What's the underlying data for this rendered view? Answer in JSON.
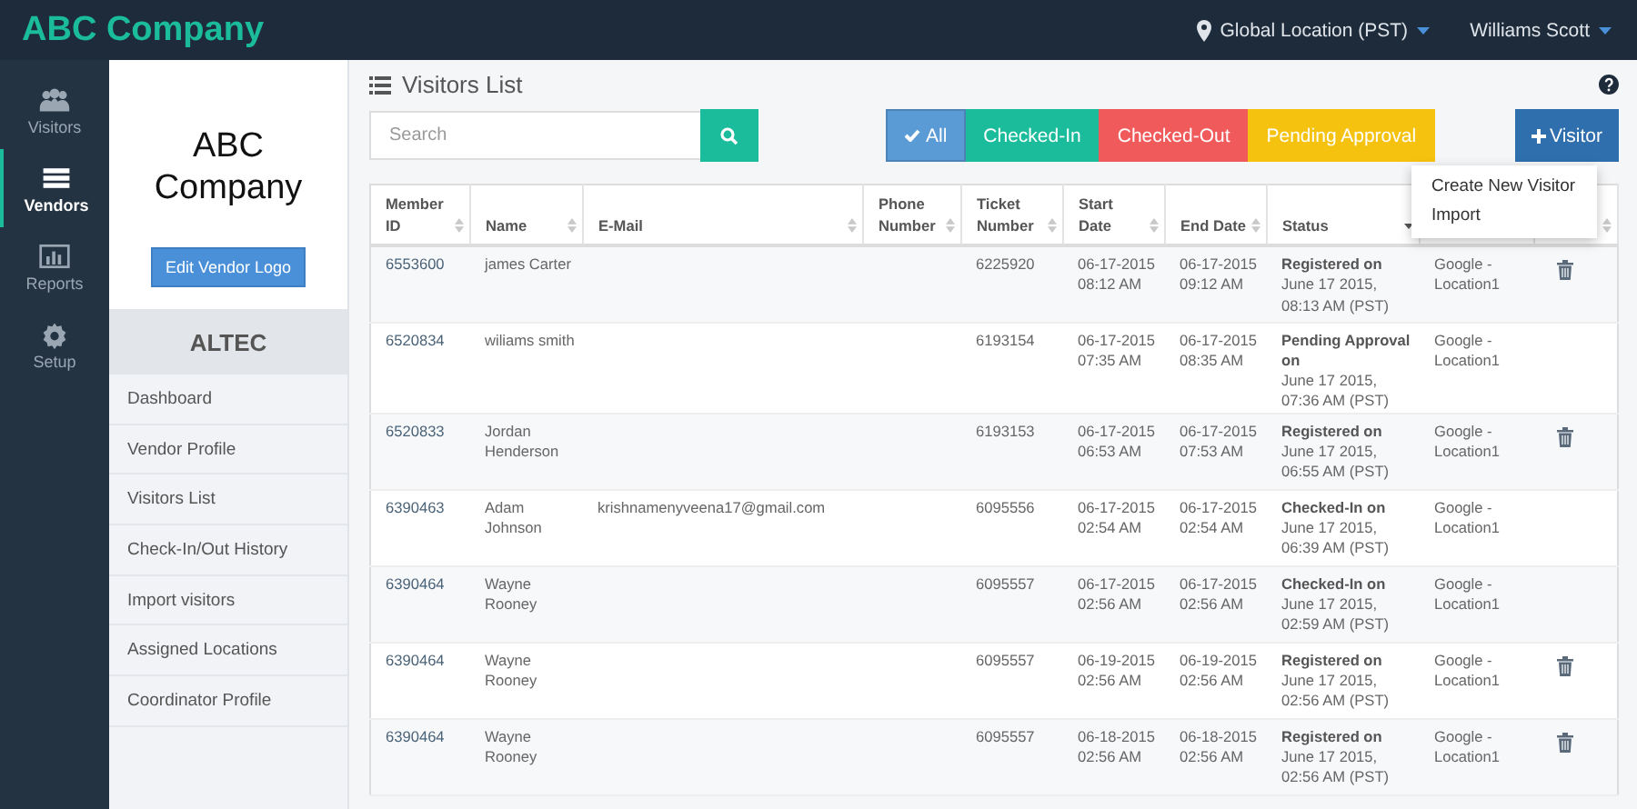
{
  "header": {
    "brand": "ABC Company",
    "location": "Global Location (PST)",
    "user": "Williams Scott"
  },
  "rail": [
    {
      "label": "Visitors",
      "selected": false
    },
    {
      "label": "Vendors",
      "selected": true
    },
    {
      "label": "Reports",
      "selected": false
    },
    {
      "label": "Setup",
      "selected": false
    }
  ],
  "vendor": {
    "logo_text": "ABC Company",
    "edit_button": "Edit Vendor Logo",
    "name": "ALTEC",
    "menu": [
      "Dashboard",
      "Vendor Profile",
      "Visitors List",
      "Check-In/Out History",
      "Import visitors",
      "Assigned Locations",
      "Coordinator Profile"
    ]
  },
  "page_title": "Visitors List",
  "search": {
    "placeholder": "Search"
  },
  "filters": [
    {
      "label": "All",
      "kind": "all",
      "selected": true
    },
    {
      "label": "Checked-In",
      "kind": "in",
      "selected": false
    },
    {
      "label": "Checked-Out",
      "kind": "out",
      "selected": false
    },
    {
      "label": "Pending Approval",
      "kind": "pending",
      "selected": false
    }
  ],
  "add_button": "Visitor",
  "add_menu": [
    "Create New Visitor",
    "Import"
  ],
  "table": {
    "columns": [
      {
        "label": "Member ID",
        "sorted": false
      },
      {
        "label": "Name",
        "sorted": false
      },
      {
        "label": "E-Mail",
        "sorted": false
      },
      {
        "label": "Phone Number",
        "sorted": false
      },
      {
        "label": "Ticket Number",
        "sorted": false
      },
      {
        "label": "Start Date",
        "sorted": false
      },
      {
        "label": "End Date",
        "sorted": false
      },
      {
        "label": "Status",
        "sorted": true
      },
      {},
      {
        "sorted": false
      }
    ],
    "rows": [
      {
        "member_id": "6553600",
        "name": "james Carter",
        "ticket": "6225920",
        "start": "06-17-2015 08:12 AM",
        "end": "06-17-2015 09:12 AM",
        "status": "Registered on",
        "status_detail": "June 17 2015, 08:13 AM (PST)",
        "location": "Google - Location1",
        "deletable": true
      },
      {
        "member_id": "6520834",
        "name": "wiliams smith",
        "ticket": "6193154",
        "start": "06-17-2015 07:35 AM",
        "end": "06-17-2015 08:35 AM",
        "status": "Pending Approval on",
        "status_detail": "June 17 2015, 07:36 AM (PST)",
        "location": "Google - Location1",
        "deletable": false
      },
      {
        "member_id": "6520833",
        "name": "Jordan Henderson",
        "ticket": "6193153",
        "start": "06-17-2015 06:53 AM",
        "end": "06-17-2015 07:53 AM",
        "status": "Registered on",
        "status_detail": "June 17 2015, 06:55 AM (PST)",
        "location": "Google - Location1",
        "deletable": true
      },
      {
        "member_id": "6390463",
        "name": "Adam Johnson",
        "email": "krishnamenyveena17@gmail.com",
        "ticket": "6095556",
        "start": "06-17-2015 02:54 AM",
        "end": "06-17-2015 02:54 AM",
        "status": "Checked-In on",
        "status_detail": "June 17 2015, 06:39 AM (PST)",
        "location": "Google - Location1",
        "deletable": false
      },
      {
        "member_id": "6390464",
        "name": "Wayne Rooney",
        "ticket": "6095557",
        "start": "06-17-2015 02:56 AM",
        "end": "06-17-2015 02:56 AM",
        "status": "Checked-In on",
        "status_detail": "June 17 2015, 02:59 AM (PST)",
        "location": "Google - Location1",
        "deletable": false
      },
      {
        "member_id": "6390464",
        "name": "Wayne Rooney",
        "ticket": "6095557",
        "start": "06-19-2015 02:56 AM",
        "end": "06-19-2015 02:56 AM",
        "status": "Registered on",
        "status_detail": "June 17 2015, 02:56 AM (PST)",
        "location": "Google - Location1",
        "deletable": true
      },
      {
        "member_id": "6390464",
        "name": "Wayne Rooney",
        "ticket": "6095557",
        "start": "06-18-2015 02:56 AM",
        "end": "06-18-2015 02:56 AM",
        "status": "Registered on",
        "status_detail": "June 17 2015, 02:56 AM (PST)",
        "location": "Google - Location1",
        "deletable": true
      }
    ]
  }
}
